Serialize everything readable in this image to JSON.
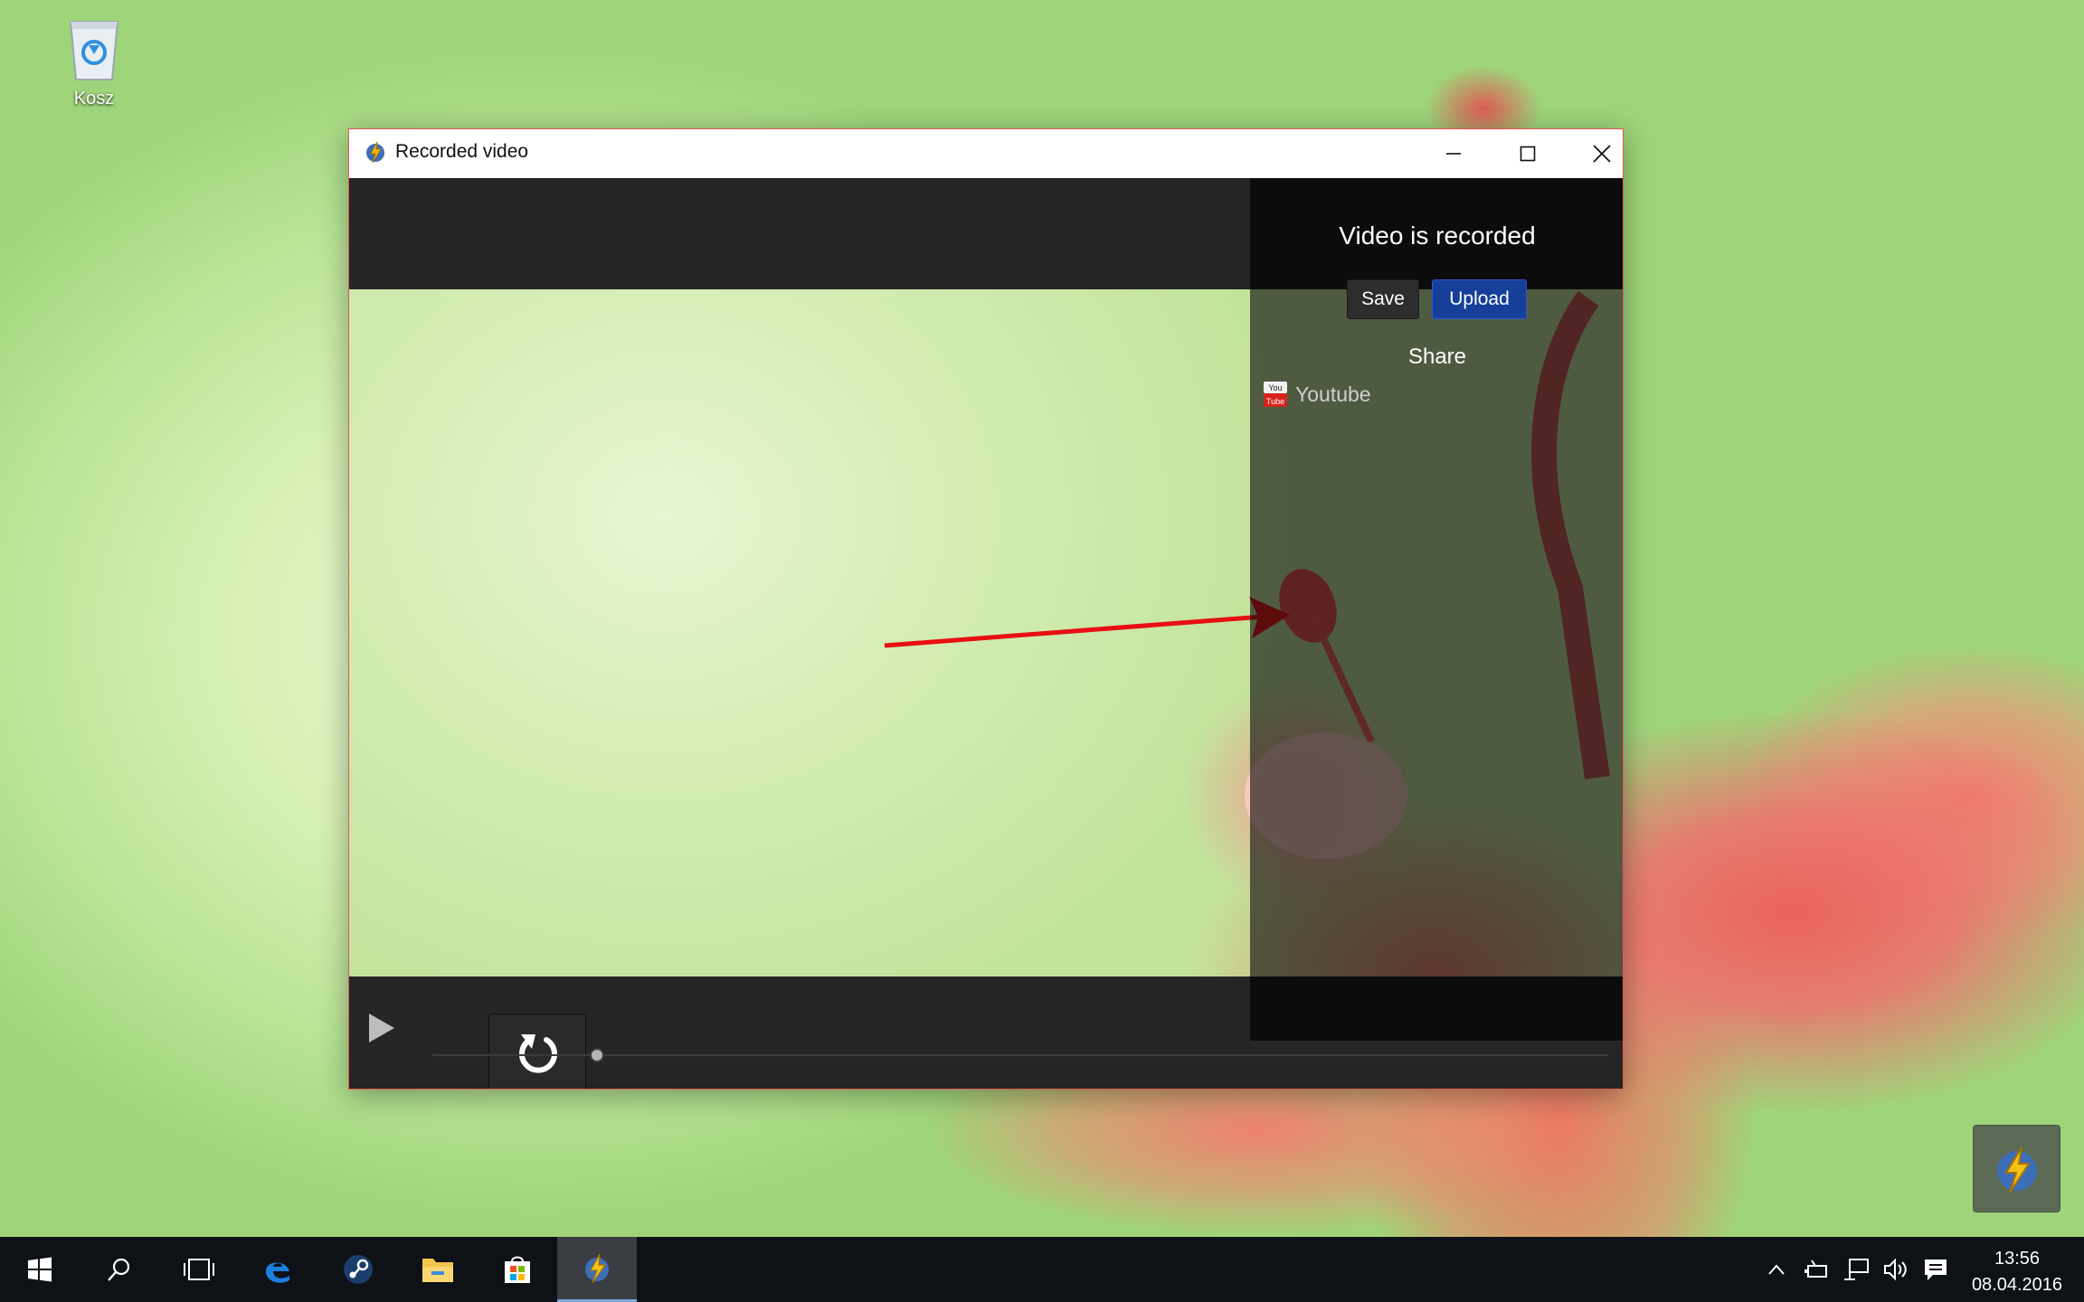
{
  "desktop": {
    "icons": [
      {
        "label": "Kosz",
        "icon": "recycle-bin-icon"
      }
    ]
  },
  "window": {
    "title": "Recorded video",
    "icon": "flash-app-icon",
    "controls": [
      "minimize-icon",
      "maximize-icon",
      "close-icon"
    ]
  },
  "panel": {
    "title": "Video is recorded",
    "save_label": "Save",
    "upload_label": "Upload",
    "share_label": "Share",
    "share_targets": [
      {
        "label": "Youtube",
        "icon": "youtube-icon"
      }
    ],
    "replay_icon": "replay-icon"
  },
  "player": {
    "play_icon": "play-icon",
    "progress": 0.14
  },
  "taskbar": {
    "items": [
      "windows-start-icon",
      "search-icon",
      "task-view-icon",
      "edge-icon",
      "steam-icon",
      "file-explorer-icon",
      "store-icon",
      "flash-app-icon"
    ],
    "tray_icons": [
      "chevron-up-icon",
      "power-icon",
      "network-icon",
      "volume-icon",
      "action-center-icon"
    ],
    "time": "13:56",
    "date": "08.04.2016"
  },
  "colors": {
    "upload_button": "#163f9a",
    "window_border": "#e05a55",
    "app_background": "#252525"
  }
}
